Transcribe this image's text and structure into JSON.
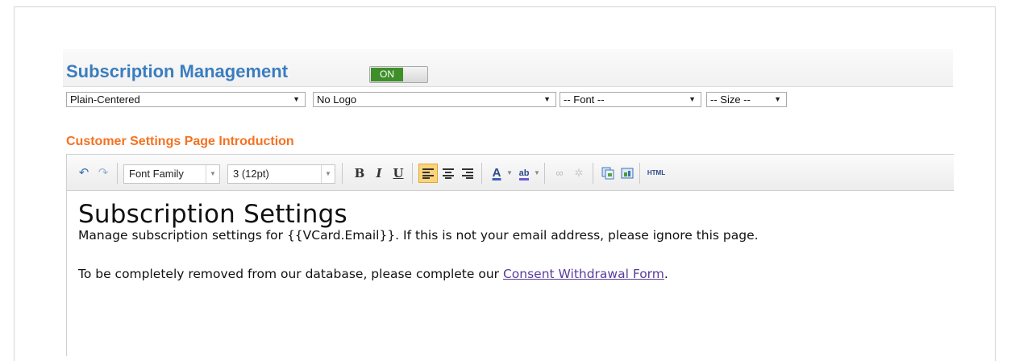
{
  "header": {
    "title": "Subscription Management",
    "toggle_label": "ON"
  },
  "selects": {
    "layout": "Plain-Centered",
    "logo": "No Logo",
    "font": "-- Font --",
    "size": "-- Size --"
  },
  "section": {
    "label": "Customer Settings Page Introduction"
  },
  "toolbar": {
    "font_family": "Font Family",
    "font_size": "3 (12pt)",
    "bold": "B",
    "italic": "I",
    "underline": "U",
    "html": "HTML",
    "icons": [
      "undo-icon",
      "redo-icon",
      "bold-icon",
      "italic-icon",
      "underline-icon",
      "align-left-icon",
      "align-center-icon",
      "align-right-icon",
      "font-color-icon",
      "highlight-color-icon",
      "link-icon",
      "unlink-icon",
      "paste-icon",
      "insert-image-icon",
      "html-source-icon"
    ]
  },
  "content": {
    "heading": "Subscription Settings",
    "line1": "Manage subscription settings for {{VCard.Email}}. If this is not your email address, please ignore this page.",
    "line2_prefix": "To be completely removed from our database, please complete our ",
    "link": "Consent Withdrawal Form",
    "line2_suffix": "."
  },
  "colors": {
    "title": "#3a7dbf",
    "section_label": "#f47221",
    "toggle_on": "#3e8e2a",
    "link": "#5a3d9a"
  }
}
